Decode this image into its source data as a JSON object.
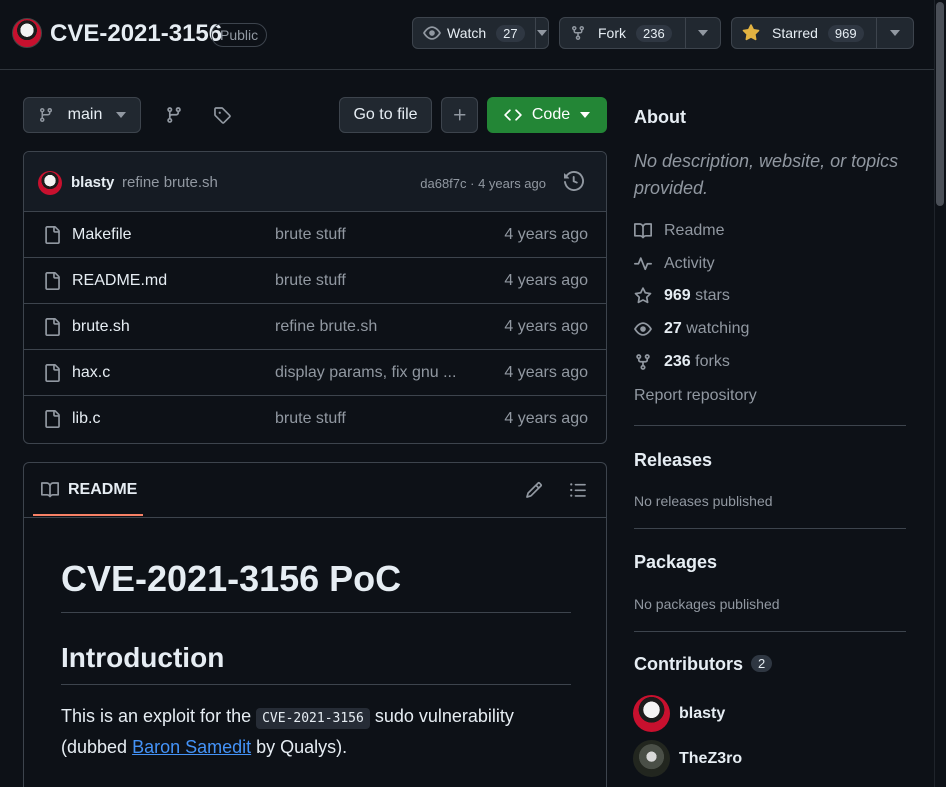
{
  "repo": {
    "name": "CVE-2021-3156",
    "visibility": "Public"
  },
  "actions": {
    "watch": {
      "label": "Watch",
      "count": "27"
    },
    "fork": {
      "label": "Fork",
      "count": "236"
    },
    "star": {
      "label": "Starred",
      "count": "969"
    }
  },
  "toolbar": {
    "branch": "main",
    "go_to_file": "Go to file",
    "code": "Code"
  },
  "commit": {
    "author": "blasty",
    "message": "refine brute.sh",
    "meta": "da68f7c · 4 years ago"
  },
  "files": [
    {
      "name": "Makefile",
      "message": "brute stuff",
      "time": "4 years ago"
    },
    {
      "name": "README.md",
      "message": "brute stuff",
      "time": "4 years ago"
    },
    {
      "name": "brute.sh",
      "message": "refine brute.sh",
      "time": "4 years ago"
    },
    {
      "name": "hax.c",
      "message": "display params, fix gnu ...",
      "time": "4 years ago"
    },
    {
      "name": "lib.c",
      "message": "brute stuff",
      "time": "4 years ago"
    }
  ],
  "readme": {
    "tab": "README",
    "h1": "CVE-2021-3156 PoC",
    "h2": "Introduction",
    "p_before": "This is an exploit for the ",
    "p_code": "CVE-2021-3156",
    "p_mid": " sudo vulnerability (dubbed ",
    "p_link": "Baron Samedit",
    "p_after": " by Qualys)."
  },
  "about": {
    "title": "About",
    "description": "No description, website, or topics provided.",
    "readme": "Readme",
    "activity": "Activity",
    "stars_count": "969",
    "stars_label": "stars",
    "watching_count": "27",
    "watching_label": "watching",
    "forks_count": "236",
    "forks_label": "forks",
    "report": "Report repository"
  },
  "releases": {
    "title": "Releases",
    "empty": "No releases published"
  },
  "packages": {
    "title": "Packages",
    "empty": "No packages published"
  },
  "contributors": {
    "title": "Contributors",
    "count": "2",
    "list": [
      {
        "name": "blasty"
      },
      {
        "name": "TheZ3ro"
      }
    ]
  },
  "colors": {
    "accent_green": "#238636",
    "link": "#4493f8",
    "tab_underline": "#f78166",
    "star": "#e3b341"
  }
}
